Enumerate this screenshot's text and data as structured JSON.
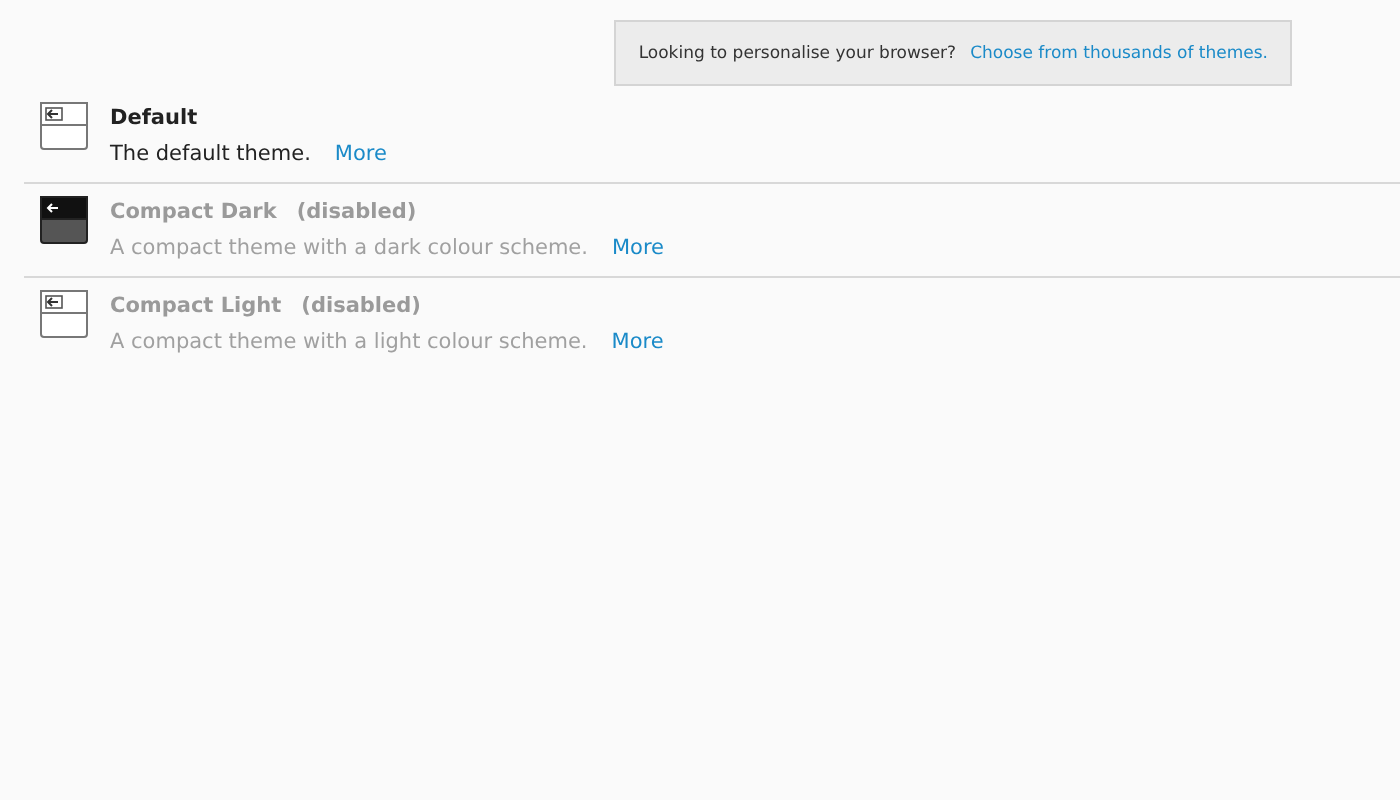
{
  "banner": {
    "text": "Looking to personalise your browser?",
    "link": "Choose from thousands of themes."
  },
  "themes": [
    {
      "name": "Default",
      "disabled": false,
      "kind": "light",
      "description": "The default theme.",
      "more": "More"
    },
    {
      "name": "Compact Dark",
      "status": "(disabled)",
      "disabled": true,
      "kind": "dark",
      "description": "A compact theme with a dark colour scheme.",
      "more": "More"
    },
    {
      "name": "Compact Light",
      "status": "(disabled)",
      "disabled": true,
      "kind": "light",
      "description": "A compact theme with a light colour scheme.",
      "more": "More"
    }
  ]
}
